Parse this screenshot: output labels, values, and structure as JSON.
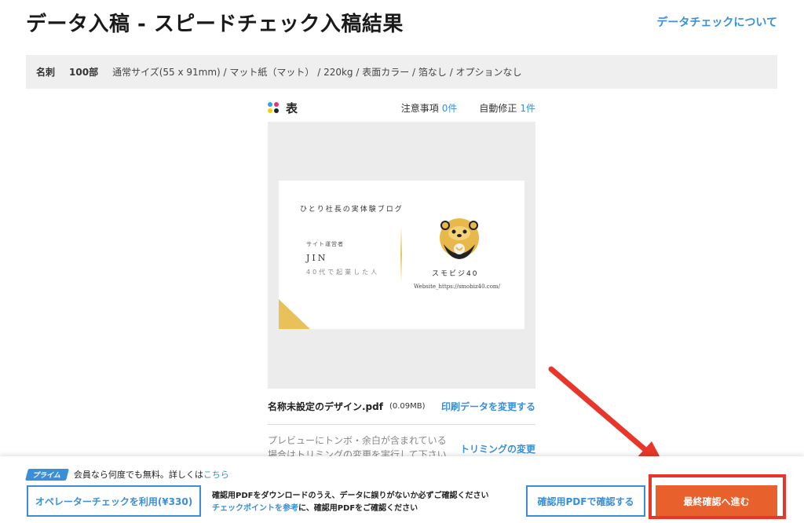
{
  "header": {
    "title": "データ入稿 - スピードチェック入稿結果",
    "help_link": "データチェックについて"
  },
  "spec": {
    "product": "名刺",
    "quantity": "100部",
    "details": "通常サイズ(55 x 91mm) / マット紙（マット） / 220kg / 表面カラー / 箔なし / オプションなし"
  },
  "preview": {
    "side_label": "表",
    "notes_label": "注意事項",
    "notes_count": "0件",
    "autofix_label": "自動修正",
    "autofix_count": "1件",
    "card": {
      "blog_title": "ひとり社長の実体験ブログ",
      "role": "サイト運営者",
      "name": "JIN",
      "tagline": "40代で起業した人",
      "brand": "スモビジ40",
      "website": "Website_https://smobiz40.com/"
    },
    "colors": {
      "card_accent": "#e9c15a",
      "mascot_body": "#222222",
      "mascot_face": "#e9b84a"
    }
  },
  "file": {
    "name": "名称未設定のデザイン.pdf",
    "size": "(0.09MB)",
    "change_link": "印刷データを変更する"
  },
  "trim": {
    "note": "プレビューにトンボ・余白が含まれている場合はトリミングの変更を実行して下さい",
    "link": "トリミングの変更"
  },
  "footer": {
    "prime_badge": "プライム",
    "prime_text": "会員なら何度でも無料。詳しくは",
    "prime_link": "こちら",
    "operator_button": "オペレーターチェックを利用(¥330)",
    "notice_line1": "確認用PDFをダウンロードのうえ、データに誤りがないか必ずご確認ください",
    "notice_link": "チェックポイントを参考",
    "notice_line2_rest": "に、確認用PDFをご確認ください",
    "pdf_button": "確認用PDFで確認する",
    "final_button": "最終確認へ進む"
  },
  "theme": {
    "accent_blue": "#3a8fd8",
    "final_orange": "#e8602c",
    "annotation_red": "#e8372a"
  }
}
